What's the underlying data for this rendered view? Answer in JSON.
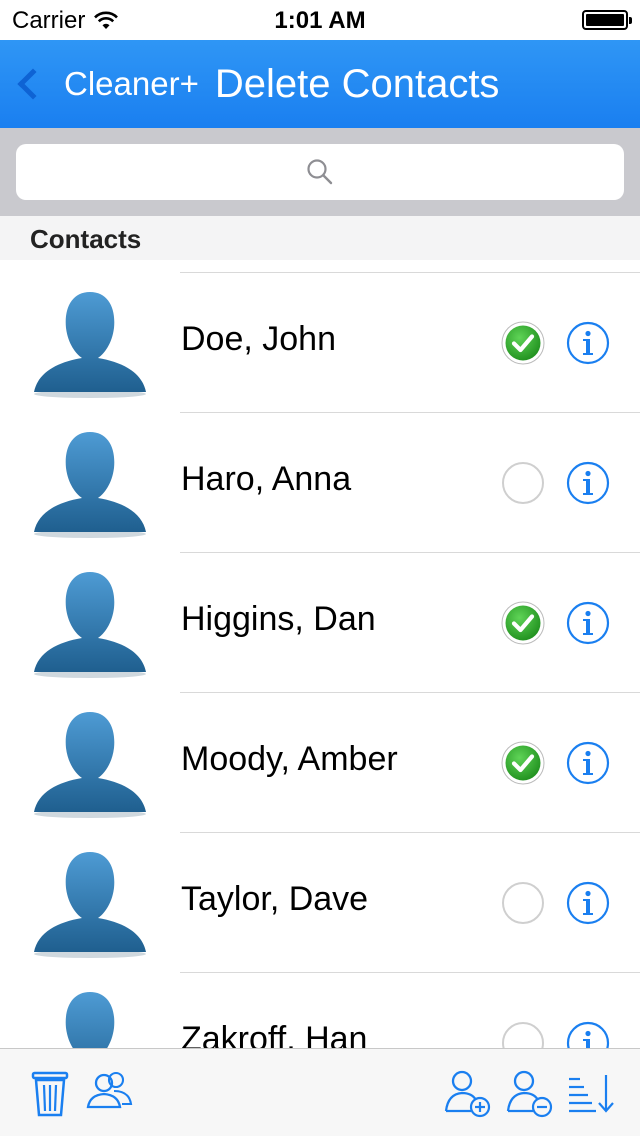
{
  "status_bar": {
    "carrier": "Carrier",
    "time": "1:01 AM"
  },
  "nav": {
    "back_label": "Cleaner+",
    "title": "Delete Contacts"
  },
  "search": {
    "placeholder": ""
  },
  "section": {
    "title": "Contacts"
  },
  "contacts": [
    {
      "name": "Doe, John",
      "selected": true
    },
    {
      "name": "Haro, Anna",
      "selected": false
    },
    {
      "name": "Higgins, Dan",
      "selected": true
    },
    {
      "name": "Moody, Amber",
      "selected": true
    },
    {
      "name": "Taylor, Dave",
      "selected": false
    },
    {
      "name": "Zakroff, Han",
      "selected": false
    }
  ],
  "colors": {
    "accent": "#1a7ff0",
    "check_green": "#2faa2a",
    "info_blue": "#1a7ff0"
  },
  "toolbar": {
    "icons": [
      "trash-icon",
      "group-icon",
      "add-contact-icon",
      "remove-contact-icon",
      "sort-icon"
    ]
  }
}
